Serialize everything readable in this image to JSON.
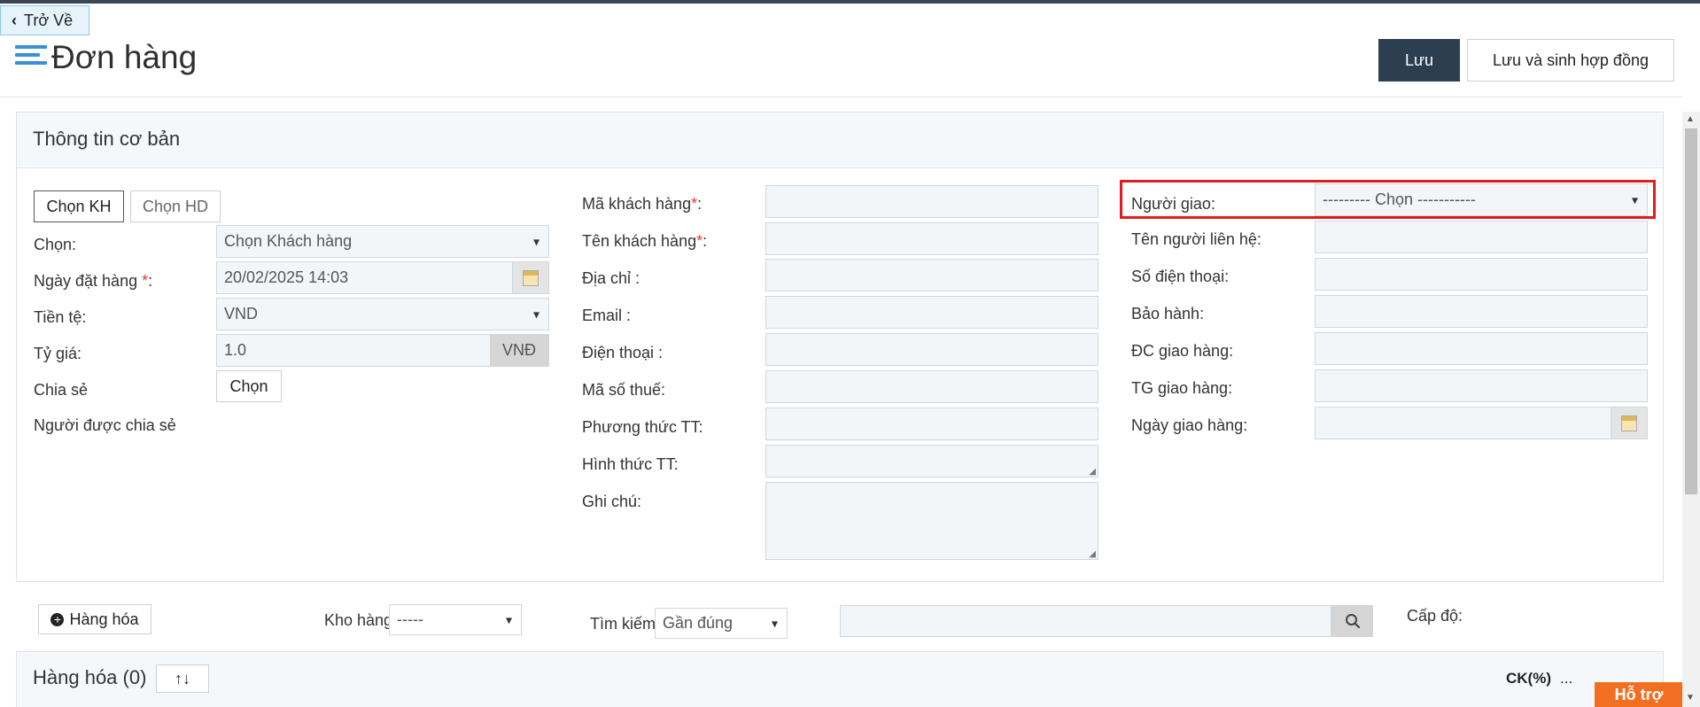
{
  "header": {
    "back_label": "Trở Về",
    "page_title": "Đơn hàng",
    "save_label": "Lưu",
    "save_contract_label": "Lưu và sinh hợp đồng"
  },
  "basic_info": {
    "title": "Thông tin cơ bản",
    "left": {
      "choose_customer_btn": "Chọn KH",
      "choose_contract_btn": "Chọn HD",
      "choose_label": "Chọn:",
      "choose_value": "Chọn Khách hàng",
      "order_date_label": "Ngày đặt hàng ",
      "order_date_value": "20/02/2025 14:03",
      "currency_label": "Tiền tệ:",
      "currency_value": "VND",
      "rate_label": "Tỷ giá:",
      "rate_value": "1.0",
      "rate_unit": "VNĐ",
      "share_label": "Chia sẻ",
      "share_btn": "Chọn",
      "shared_with_label": "Người được chia sẻ"
    },
    "middle": {
      "customer_code_label": "Mã khách hàng",
      "customer_name_label": "Tên khách hàng",
      "address_label": "Địa chỉ :",
      "email_label": "Email :",
      "phone_label": "Điện thoại :",
      "tax_code_label": "Mã số thuế:",
      "payment_method_label": "Phương thức TT:",
      "payment_form_label": "Hình thức TT:",
      "note_label": "Ghi chú:"
    },
    "right": {
      "deliverer_label": "Người giao:",
      "deliverer_value": "--------- Chọn -----------",
      "contact_name_label": "Tên người liên hệ:",
      "contact_phone_label": "Số điện thoại:",
      "warranty_label": "Bảo hành:",
      "delivery_address_label": "ĐC giao hàng:",
      "delivery_time_label": "TG giao hàng:",
      "delivery_date_label": "Ngày giao hàng:"
    },
    "required_mark": "*"
  },
  "goods_bar": {
    "add_goods_label": "Hàng hóa",
    "warehouse_label": "Kho hàng",
    "warehouse_value": "-----",
    "search_label": "Tìm kiếm",
    "search_mode_value": "Gần đúng",
    "level_label": "Cấp độ:"
  },
  "goods_section": {
    "title": "Hàng hóa (0)",
    "discount_label": "CK(%)",
    "more_label": "...",
    "support_label": "Hỗ trợ"
  },
  "colors": {
    "primary_dark": "#2c3e50",
    "highlight": "#e21b1b",
    "support": "#f26f21",
    "icon_blue": "#3b8fd6"
  }
}
